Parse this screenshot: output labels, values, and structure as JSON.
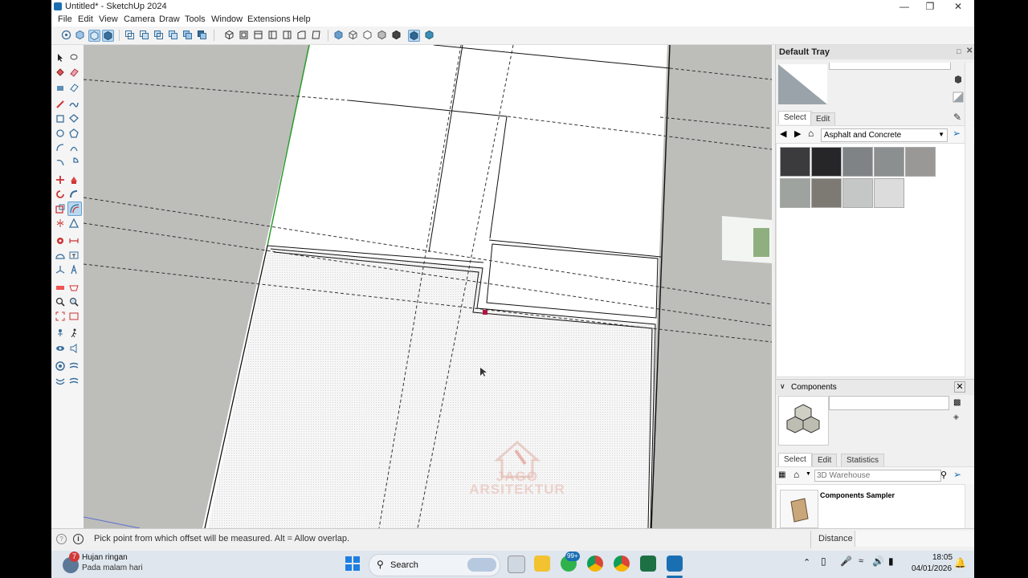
{
  "window": {
    "title": "Untitled* - SketchUp 2024",
    "minimize_icon": "minimize-icon",
    "maximize_icon": "restore-icon",
    "close_icon": "close-icon"
  },
  "menu": [
    "File",
    "Edit",
    "View",
    "Camera",
    "Draw",
    "Tools",
    "Window",
    "Extensions",
    "Help"
  ],
  "viewport": {
    "watermark_line1": "JAGO",
    "watermark_line2": "ARSITEKTUR"
  },
  "tray": {
    "title": "Default Tray",
    "materials": {
      "tabs": [
        "Select",
        "Edit"
      ],
      "library": "Asphalt and Concrete",
      "swatch_colors": [
        "#3b3a3c",
        "#262628",
        "#7f8385",
        "#8c8f8f",
        "#9a9897",
        "#9ea3a0",
        "#7d7a73",
        "#c5c6c6",
        "#dcdcdc"
      ]
    },
    "components": {
      "title": "Components",
      "tabs": [
        "Select",
        "Edit",
        "Statistics"
      ],
      "search_placeholder": "3D Warehouse",
      "item_label": "Components Sampler"
    }
  },
  "status": {
    "message": "Pick point from which offset will be measured. Alt = Allow overlap.",
    "measure_label": "Distance"
  },
  "taskbar": {
    "weather_badge": "7",
    "weather_title": "Hujan ringan",
    "weather_sub": "Pada malam hari",
    "search_label": "Search",
    "whatsapp_badge": "99+",
    "time": "18:05",
    "date": "04/01/2026"
  },
  "colors": {
    "accent": "#1a6fb3",
    "viewport_bg": "#bdbdba",
    "green_axis": "#2c9a2c"
  }
}
